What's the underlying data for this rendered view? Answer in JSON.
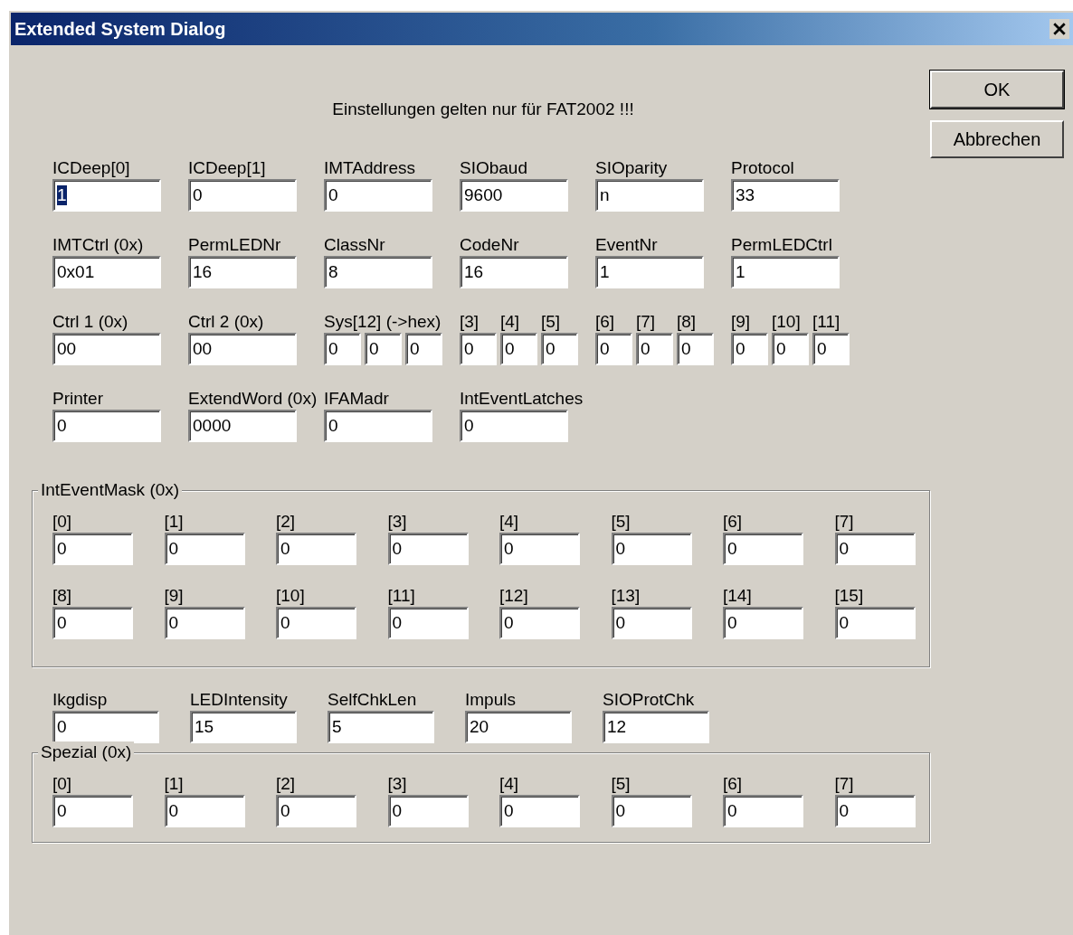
{
  "window": {
    "title": "Extended System Dialog"
  },
  "notice": "Einstellungen gelten nur für FAT2002 !!!",
  "buttons": [
    {
      "label": "OK",
      "default": true
    },
    {
      "label": "Abbrechen",
      "default": false
    }
  ],
  "rows": [
    {
      "fields": [
        {
          "kind": "wide",
          "label": "ICDeep[0]",
          "value": "1",
          "selected": true
        },
        {
          "kind": "wide",
          "label": "ICDeep[1]",
          "value": "0",
          "selected": false
        },
        {
          "kind": "wide",
          "label": "IMTAddress",
          "value": "0",
          "selected": false
        },
        {
          "kind": "wide",
          "label": "SIObaud",
          "value": "9600",
          "selected": false
        },
        {
          "kind": "wide",
          "label": "SIOparity",
          "value": "n",
          "selected": false
        },
        {
          "kind": "wide",
          "label": "Protocol",
          "value": "33",
          "selected": false
        }
      ]
    },
    {
      "fields": [
        {
          "kind": "wide",
          "label": "IMTCtrl (0x)",
          "value": "0x01",
          "selected": false
        },
        {
          "kind": "wide",
          "label": "PermLEDNr",
          "value": "16",
          "selected": false
        },
        {
          "kind": "wide",
          "label": "ClassNr",
          "value": "8",
          "selected": false
        },
        {
          "kind": "wide",
          "label": "CodeNr",
          "value": "16",
          "selected": false
        },
        {
          "kind": "wide",
          "label": "EventNr",
          "value": "1",
          "selected": false
        },
        {
          "kind": "wide",
          "label": "PermLEDCtrl",
          "value": "1",
          "selected": false
        }
      ]
    },
    {
      "fields": [
        {
          "kind": "wide",
          "label": "Ctrl 1 (0x)",
          "value": "00",
          "selected": false
        },
        {
          "kind": "wide",
          "label": "Ctrl 2 (0x)",
          "value": "00",
          "selected": false
        },
        {
          "kind": "narrow",
          "label": "Sys[12] (->hex)",
          "value": "0",
          "selected": false
        },
        {
          "kind": "narrow",
          "value": "0",
          "selected": false
        },
        {
          "kind": "narrow",
          "value": "0",
          "selected": false
        },
        {
          "kind": "narrow",
          "label": "[3]",
          "value": "0",
          "selected": false
        },
        {
          "kind": "narrow",
          "label": "[4]",
          "value": "0",
          "selected": false
        },
        {
          "kind": "narrow",
          "label": "[5]",
          "value": "0",
          "selected": false
        },
        {
          "kind": "narrow",
          "label": "[6]",
          "value": "0",
          "selected": false
        },
        {
          "kind": "narrow",
          "label": "[7]",
          "value": "0",
          "selected": false
        },
        {
          "kind": "narrow",
          "label": "[8]",
          "value": "0",
          "selected": false
        },
        {
          "kind": "narrow",
          "label": "[9]",
          "value": "0",
          "selected": false
        },
        {
          "kind": "narrow",
          "label": "[10]",
          "value": "0",
          "selected": false
        },
        {
          "kind": "narrow",
          "label": "[11]",
          "value": "0",
          "selected": false
        }
      ]
    },
    {
      "fields": [
        {
          "kind": "wide",
          "label": "Printer",
          "value": "0",
          "selected": false
        },
        {
          "kind": "wide",
          "label": "ExtendWord (0x)",
          "value": "0000",
          "selected": false
        },
        {
          "kind": "wide",
          "label": "IFAMadr",
          "value": "0",
          "selected": false
        },
        {
          "kind": "wide",
          "label": "IntEventLatches",
          "value": "0",
          "selected": false
        }
      ]
    }
  ],
  "int_event_mask": {
    "title": "IntEventMask (0x)",
    "fields": [
      {
        "label": "[0]",
        "value": "0"
      },
      {
        "label": "[1]",
        "value": "0"
      },
      {
        "label": "[2]",
        "value": "0"
      },
      {
        "label": "[3]",
        "value": "0"
      },
      {
        "label": "[4]",
        "value": "0"
      },
      {
        "label": "[5]",
        "value": "0"
      },
      {
        "label": "[6]",
        "value": "0"
      },
      {
        "label": "[7]",
        "value": "0"
      },
      {
        "label": "[8]",
        "value": "0"
      },
      {
        "label": "[9]",
        "value": "0"
      },
      {
        "label": "[10]",
        "value": "0"
      },
      {
        "label": "[11]",
        "value": "0"
      },
      {
        "label": "[12]",
        "value": "0"
      },
      {
        "label": "[13]",
        "value": "0"
      },
      {
        "label": "[14]",
        "value": "0"
      },
      {
        "label": "[15]",
        "value": "0"
      }
    ]
  },
  "lower_fields": [
    {
      "label": "Ikgdisp",
      "value": "0"
    },
    {
      "label": "LEDIntensity",
      "value": "15"
    },
    {
      "label": "SelfChkLen",
      "value": "5"
    },
    {
      "label": "Impuls",
      "value": "20"
    },
    {
      "label": "SIOProtChk",
      "value": "12"
    }
  ],
  "spezial": {
    "title": "Spezial (0x)",
    "fields": [
      {
        "label": "[0]",
        "value": "0"
      },
      {
        "label": "[1]",
        "value": "0"
      },
      {
        "label": "[2]",
        "value": "0"
      },
      {
        "label": "[3]",
        "value": "0"
      },
      {
        "label": "[4]",
        "value": "0"
      },
      {
        "label": "[5]",
        "value": "0"
      },
      {
        "label": "[6]",
        "value": "0"
      },
      {
        "label": "[7]",
        "value": "0"
      }
    ]
  }
}
